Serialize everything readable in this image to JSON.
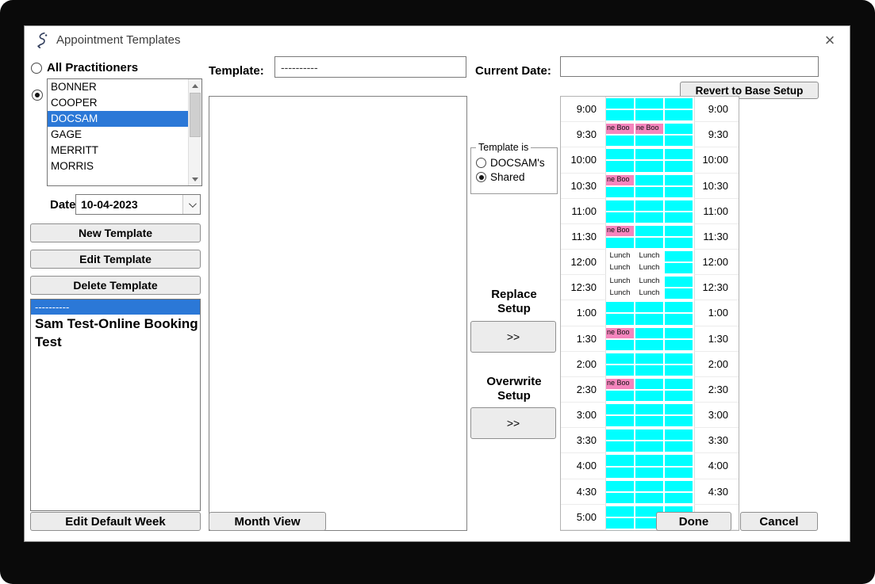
{
  "window": {
    "title": "Appointment Templates"
  },
  "icons": {
    "close": "×"
  },
  "practitioners": {
    "all_label": "All Practitioners",
    "items": [
      "BONNER",
      "COOPER",
      "DOCSAM",
      "GAGE",
      "MERRITT",
      "MORRIS"
    ],
    "selected": "DOCSAM"
  },
  "date_picker": {
    "label": "Date",
    "value": "10-04-2023"
  },
  "left_buttons": {
    "new_template": "New Template",
    "edit_template": "Edit Template",
    "delete_template": "Delete Template",
    "edit_default_week": "Edit Default Week"
  },
  "template_list": {
    "items": [
      {
        "label": "----------",
        "selected": true,
        "emphasis": false
      },
      {
        "label": "Sam Test-Online Booking",
        "selected": false,
        "emphasis": true
      },
      {
        "label": "Test",
        "selected": false,
        "emphasis": true
      }
    ]
  },
  "template_field": {
    "label": "Template:",
    "value": "----------"
  },
  "current_date_field": {
    "label": "Current Date:",
    "value": ""
  },
  "revert_button": "Revert to Base Setup",
  "template_is": {
    "legend": "Template is",
    "options": [
      "DOCSAM's",
      "Shared"
    ],
    "selected": "Shared"
  },
  "transfer": {
    "replace_label": "Replace\nSetup",
    "overwrite_label": "Overwrite\nSetup",
    "button_label": ">>"
  },
  "footer_buttons": {
    "month_view": "Month View",
    "done": "Done",
    "cancel": "Cancel"
  },
  "schedule": {
    "times": [
      "9:00",
      "9:30",
      "10:00",
      "10:30",
      "11:00",
      "11:30",
      "12:00",
      "12:30",
      "1:00",
      "1:30",
      "2:00",
      "2:30",
      "3:00",
      "3:30",
      "4:00",
      "4:30",
      "5:00"
    ],
    "columns": 3,
    "slots_per_row": 2,
    "colors": {
      "open": "#00FFFF",
      "booking": "#F585BD",
      "lunch": "#FFFFFF"
    },
    "events": [
      {
        "time": "9:30",
        "col": 0,
        "slot": 0,
        "type": "booking",
        "label": "ne Boo"
      },
      {
        "time": "9:30",
        "col": 1,
        "slot": 0,
        "type": "booking",
        "label": "ne Boo"
      },
      {
        "time": "10:30",
        "col": 0,
        "slot": 0,
        "type": "booking",
        "label": "ne Boo"
      },
      {
        "time": "11:30",
        "col": 0,
        "slot": 0,
        "type": "booking",
        "label": "ne Boo"
      },
      {
        "time": "12:00",
        "col": 0,
        "slot": 0,
        "type": "lunch",
        "label": "Lunch"
      },
      {
        "time": "12:00",
        "col": 1,
        "slot": 0,
        "type": "lunch",
        "label": "Lunch"
      },
      {
        "time": "12:00",
        "col": 0,
        "slot": 1,
        "type": "lunch",
        "label": "Lunch"
      },
      {
        "time": "12:00",
        "col": 1,
        "slot": 1,
        "type": "lunch",
        "label": "Lunch"
      },
      {
        "time": "12:30",
        "col": 0,
        "slot": 0,
        "type": "lunch",
        "label": "Lunch"
      },
      {
        "time": "12:30",
        "col": 1,
        "slot": 0,
        "type": "lunch",
        "label": "Lunch"
      },
      {
        "time": "12:30",
        "col": 0,
        "slot": 1,
        "type": "lunch",
        "label": "Lunch"
      },
      {
        "time": "12:30",
        "col": 1,
        "slot": 1,
        "type": "lunch",
        "label": "Lunch"
      },
      {
        "time": "1:30",
        "col": 0,
        "slot": 0,
        "type": "booking",
        "label": "ne Boo"
      },
      {
        "time": "2:30",
        "col": 0,
        "slot": 0,
        "type": "booking",
        "label": "ne Boo"
      }
    ]
  }
}
